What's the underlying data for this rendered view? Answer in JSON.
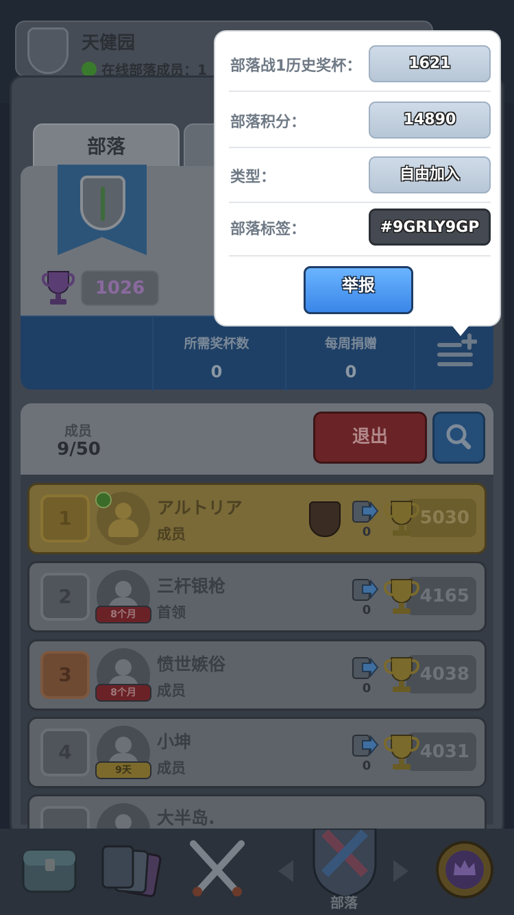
{
  "clan": {
    "name": "天健园",
    "online_text": "在线部落成员：1",
    "trophies": "1026",
    "tab_label": "部落"
  },
  "stats": {
    "required_trophies_label": "所需奖杯数",
    "required_trophies_value": "0",
    "weekly_donations_label": "每周捐赠",
    "weekly_donations_value": "0"
  },
  "members": {
    "label": "成员",
    "count": "9/50",
    "leave_label": "退出",
    "list": [
      {
        "rank": "1",
        "name": "アルトリア",
        "role": "成员",
        "cards": "0",
        "trophies": "5030",
        "tenure": ""
      },
      {
        "rank": "2",
        "name": "三杆银枪",
        "role": "首领",
        "cards": "0",
        "trophies": "4165",
        "tenure": "8个月"
      },
      {
        "rank": "3",
        "name": "愤世嫉俗",
        "role": "成员",
        "cards": "0",
        "trophies": "4038",
        "tenure": "8个月"
      },
      {
        "rank": "4",
        "name": "小坤",
        "role": "成员",
        "cards": "0",
        "trophies": "4031",
        "tenure": "9天"
      },
      {
        "rank": "",
        "name": "大半岛.",
        "role": "",
        "cards": "",
        "trophies": "",
        "tenure": ""
      }
    ]
  },
  "popup": {
    "war_trophies_label": "部落战1历史奖杯：",
    "war_trophies_value": "1621",
    "clan_score_label": "部落积分：",
    "clan_score_value": "14890",
    "type_label": "类型：",
    "type_value": "自由加入",
    "tag_label": "部落标签：",
    "tag_value": "#9GRLY9GP",
    "report_label": "举报"
  },
  "bottom_nav": {
    "active_label": "部落"
  },
  "icons": {
    "trophy": "trophy-icon",
    "cards": "cards-icon",
    "search": "search-icon",
    "menu": "menu-add-icon"
  },
  "colors": {
    "accent_blue": "#3a86e8",
    "leave_red": "#6a2326",
    "gold_row": "#7a6a38"
  }
}
